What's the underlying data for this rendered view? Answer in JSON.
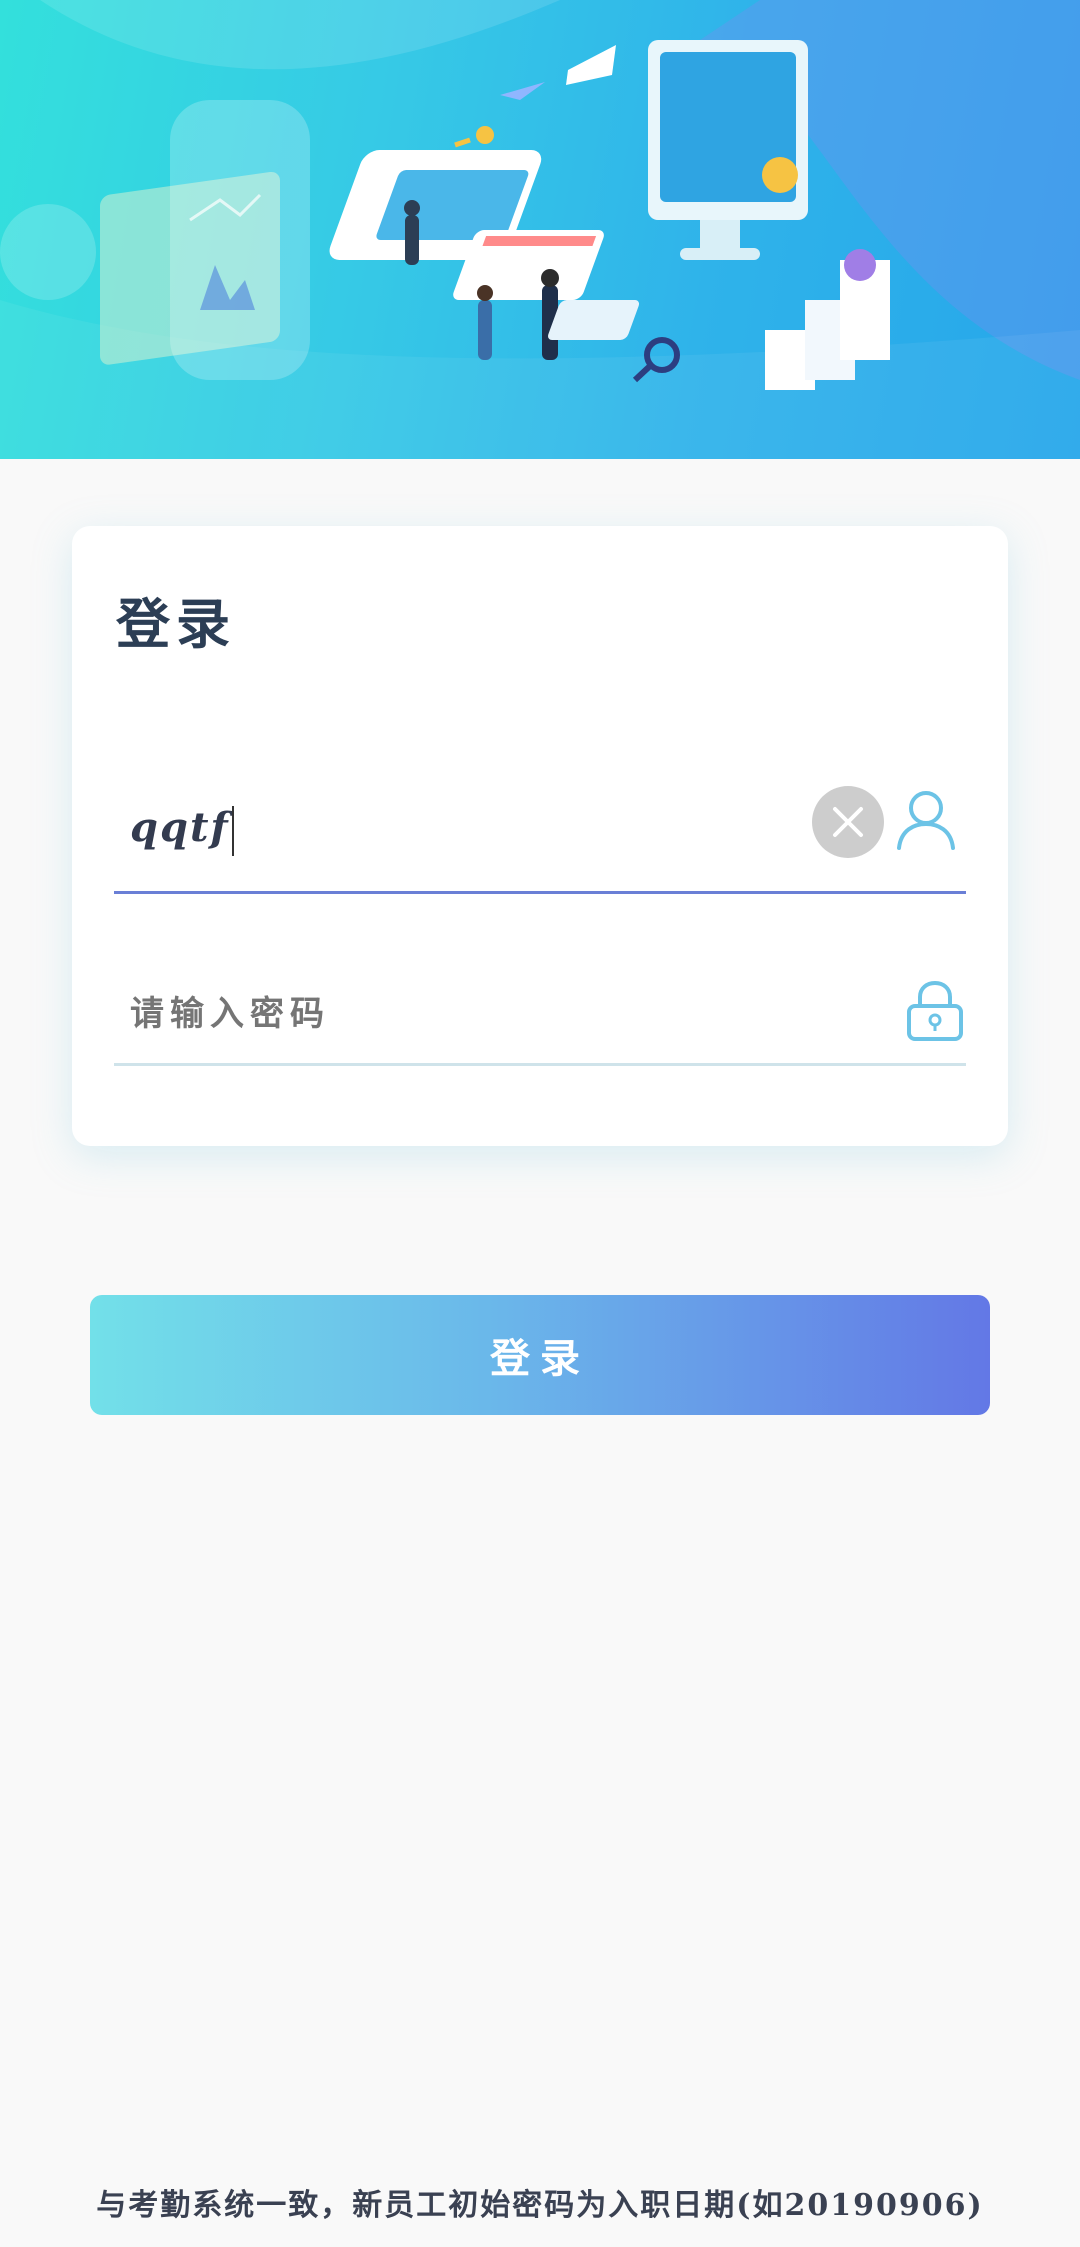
{
  "login": {
    "title": "登录",
    "username": {
      "value": "qqtf",
      "clear_icon": "close-circle-icon",
      "icon": "user-icon"
    },
    "password": {
      "placeholder": "请输入密码",
      "icon": "lock-icon"
    },
    "submit_label": "登录"
  },
  "footer": {
    "note": "与考勤系统一致，新员工初始密码为入职日期(如20190906)"
  },
  "colors": {
    "accent": "#6a7fd6",
    "button_start": "#72e0e9",
    "button_end": "#6378e6",
    "icon": "#6cc3e6"
  }
}
